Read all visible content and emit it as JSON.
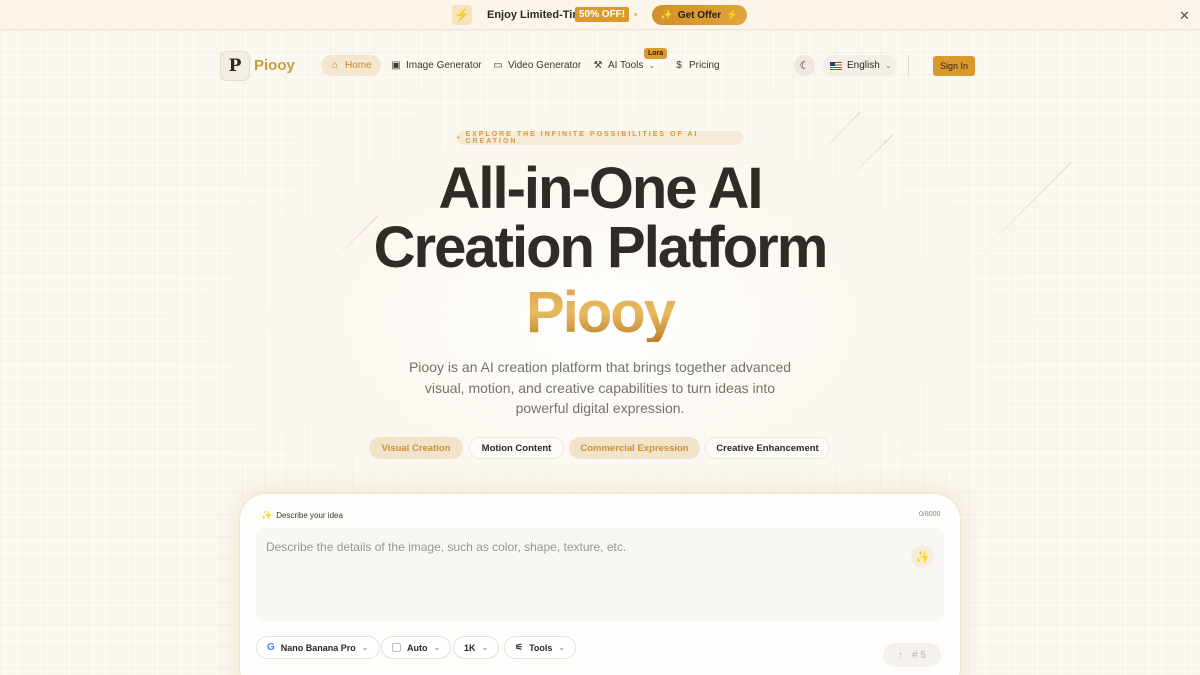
{
  "promo": {
    "text": "Enjoy Limited-Time",
    "badge": "50% OFF!",
    "button": "Get Offer",
    "close": "✕"
  },
  "brand": {
    "logo_letter": "P",
    "name": "Piooy"
  },
  "nav": {
    "items": [
      {
        "label": "Home",
        "icon": "home-icon"
      },
      {
        "label": "Image Generator",
        "icon": "image-icon"
      },
      {
        "label": "Video Generator",
        "icon": "video-icon"
      },
      {
        "label": "AI Tools",
        "icon": "wrench-icon",
        "badge": "Lora"
      },
      {
        "label": "Pricing",
        "icon": "dollar-icon"
      }
    ],
    "language": "English",
    "sign_in": "Sign In"
  },
  "hero": {
    "eyebrow": "EXPLORE THE INFINITE POSSIBILITIES OF AI CREATION",
    "line1": "All-in-One AI",
    "line2": "Creation Platform",
    "brand": "Piooy",
    "description": "Piooy is an AI creation platform that brings together advanced visual, motion, and creative capabilities to turn ideas into powerful digital expression.",
    "chips": [
      "Visual Creation",
      "Motion Content",
      "Commercial Expression",
      "Creative Enhancement"
    ]
  },
  "composer": {
    "label": "Describe your idea",
    "char_count": "0/8000",
    "placeholder": "Describe the details of the image, such as color, shape, texture, etc.",
    "model": "Nano Banana Pro",
    "aspect": "Auto",
    "resolution": "1K",
    "tools": "Tools",
    "credits": "5"
  },
  "colors": {
    "accent": "#d99a2b",
    "accent_light": "#f2e3cb",
    "background": "#fbf8f2"
  }
}
